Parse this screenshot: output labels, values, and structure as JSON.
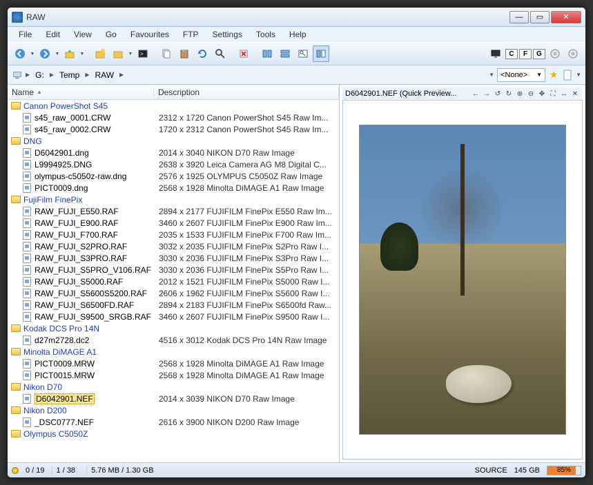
{
  "window": {
    "title": "RAW"
  },
  "menu": [
    "File",
    "Edit",
    "View",
    "Go",
    "Favourites",
    "FTP",
    "Settings",
    "Tools",
    "Help"
  ],
  "pathbar": {
    "segments": [
      "G:",
      "Temp",
      "RAW"
    ],
    "filter": "<None>"
  },
  "columns": {
    "name": "Name",
    "desc": "Description"
  },
  "tree": [
    {
      "type": "folder",
      "name": "Canon PowerShot S45"
    },
    {
      "type": "file",
      "name": "s45_raw_0001.CRW",
      "desc": "2312 x 1720 Canon PowerShot S45 Raw Im..."
    },
    {
      "type": "file",
      "name": "s45_raw_0002.CRW",
      "desc": "1720 x 2312 Canon PowerShot S45 Raw Im..."
    },
    {
      "type": "folder",
      "name": "DNG"
    },
    {
      "type": "file",
      "name": "D6042901.dng",
      "desc": "2014 x 3040 NIKON D70 Raw Image"
    },
    {
      "type": "file",
      "name": "L9994925.DNG",
      "desc": "2638 x 3920 Leica Camera AG M8 Digital C..."
    },
    {
      "type": "file",
      "name": "olympus-c5050z-raw.dng",
      "desc": "2576 x 1925 OLYMPUS C5050Z Raw Image"
    },
    {
      "type": "file",
      "name": "PICT0009.dng",
      "desc": "2568 x 1928 Minolta DiMAGE A1 Raw Image"
    },
    {
      "type": "folder",
      "name": "FujiFilm FinePix"
    },
    {
      "type": "file",
      "name": "RAW_FUJI_E550.RAF",
      "desc": "2894 x 2177 FUJIFILM FinePix E550 Raw Im..."
    },
    {
      "type": "file",
      "name": "RAW_FUJI_E900.RAF",
      "desc": "3460 x 2607 FUJIFILM FinePix E900 Raw Im..."
    },
    {
      "type": "file",
      "name": "RAW_FUJI_F700.RAF",
      "desc": "2035 x 1533 FUJIFILM FinePix F700 Raw Im..."
    },
    {
      "type": "file",
      "name": "RAW_FUJI_S2PRO.RAF",
      "desc": "3032 x 2035 FUJIFILM FinePix S2Pro Raw I..."
    },
    {
      "type": "file",
      "name": "RAW_FUJI_S3PRO.RAF",
      "desc": "3030 x 2036 FUJIFILM FinePix S3Pro Raw I..."
    },
    {
      "type": "file",
      "name": "RAW_FUJI_S5PRO_V106.RAF",
      "desc": "3030 x 2036 FUJIFILM FinePix S5Pro Raw I..."
    },
    {
      "type": "file",
      "name": "RAW_FUJI_S5000.RAF",
      "desc": "2012 x 1521 FUJIFILM FinePix S5000 Raw I..."
    },
    {
      "type": "file",
      "name": "RAW_FUJI_S5600S5200.RAF",
      "desc": "2606 x 1962 FUJIFILM FinePix S5600 Raw I..."
    },
    {
      "type": "file",
      "name": "RAW_FUJI_S6500FD.RAF",
      "desc": "2894 x 2183 FUJIFILM FinePix S6500fd Raw..."
    },
    {
      "type": "file",
      "name": "RAW_FUJI_S9500_SRGB.RAF",
      "desc": "3460 x 2607 FUJIFILM FinePix S9500 Raw I..."
    },
    {
      "type": "folder",
      "name": "Kodak DCS Pro 14N"
    },
    {
      "type": "file",
      "name": "d27m2728.dc2",
      "desc": "4516 x 3012 Kodak DCS Pro 14N Raw Image"
    },
    {
      "type": "folder",
      "name": "Minolta DiMAGE A1"
    },
    {
      "type": "file",
      "name": "PICT0009.MRW",
      "desc": "2568 x 1928 Minolta DiMAGE A1 Raw Image"
    },
    {
      "type": "file",
      "name": "PICT0015.MRW",
      "desc": "2568 x 1928 Minolta DiMAGE A1 Raw Image"
    },
    {
      "type": "folder",
      "name": "Nikon D70"
    },
    {
      "type": "file",
      "name": "D6042901.NEF",
      "desc": "2014 x 3039 NIKON D70 Raw Image",
      "selected": true
    },
    {
      "type": "folder",
      "name": "Nikon D200"
    },
    {
      "type": "file",
      "name": "_DSC0777.NEF",
      "desc": "2616 x 3900 NIKON D200 Raw Image"
    },
    {
      "type": "folder",
      "name": "Olympus C5050Z"
    }
  ],
  "preview": {
    "title": "D6042901.NEF (Quick Preview..."
  },
  "status": {
    "sel": "0 / 19",
    "idx": "1 / 38",
    "size": "5.76 MB / 1.30 GB",
    "src": "SOURCE",
    "free": "145 GB",
    "pct": "85%"
  },
  "rbuttons": [
    "C",
    "F",
    "G"
  ]
}
